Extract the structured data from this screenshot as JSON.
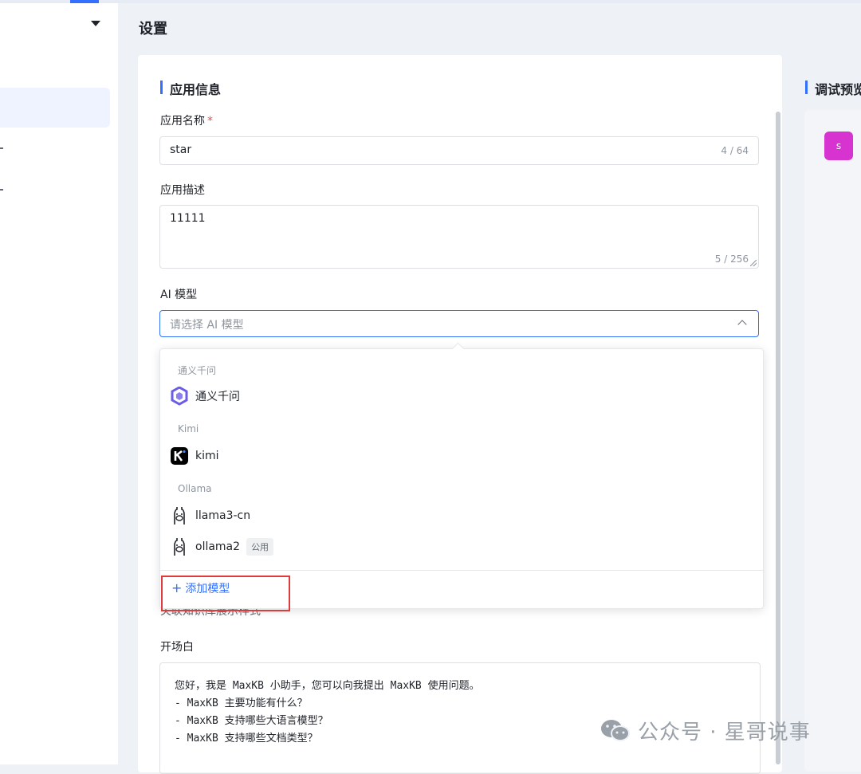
{
  "page": {
    "title": "设置"
  },
  "app_info": {
    "section_title": "应用信息",
    "name_label": "应用名称",
    "required_mark": "*",
    "name_value": "star",
    "name_count": "4 / 64",
    "desc_label": "应用描述",
    "desc_value": "11111",
    "desc_count": "5 / 256",
    "model_label": "AI 模型",
    "model_placeholder": "请选择 AI 模型"
  },
  "dropdown": {
    "groups": [
      {
        "label": "通义千问",
        "options": [
          {
            "name": "通义千问",
            "icon": "tongyi-qianwen-icon"
          }
        ]
      },
      {
        "label": "Kimi",
        "options": [
          {
            "name": "kimi",
            "icon": "kimi-icon"
          }
        ]
      },
      {
        "label": "Ollama",
        "options": [
          {
            "name": "llama3-cn",
            "icon": "ollama-icon"
          },
          {
            "name": "ollama2",
            "icon": "ollama-icon",
            "tag": "公用"
          }
        ]
      }
    ],
    "add_model_label": "添加模型",
    "add_model_icon": "plus-icon"
  },
  "obscured_text": "关联知识库展示样式",
  "prologue": {
    "label": "开场白",
    "lines": [
      "您好，我是 MaxKB 小助手，您可以向我提出 MaxKB 使用问题。",
      "- MaxKB 主要功能有什么？",
      "- MaxKB 支持哪些大语言模型？",
      "- MaxKB 支持哪些文档类型？"
    ]
  },
  "preview": {
    "title": "调试预览",
    "avatar_text": "s"
  },
  "watermark": {
    "text": "公众号 · 星哥说事",
    "icon": "wechat-icon"
  },
  "colors": {
    "accent": "#3370ff",
    "avatar": "#d633d0",
    "highlight_border": "#e03b3b",
    "required": "#f54a45"
  }
}
